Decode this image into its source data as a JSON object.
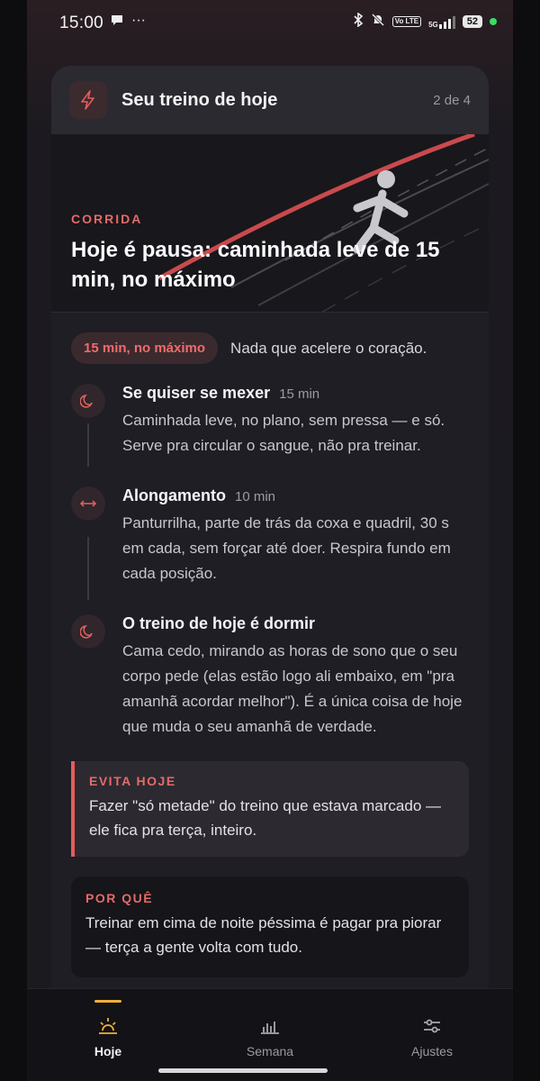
{
  "status": {
    "time": "15:00",
    "battery": "52",
    "volte": "Vo LTE",
    "network": "5G"
  },
  "header": {
    "title": "Seu treino de hoje",
    "count": "2 de 4"
  },
  "hero": {
    "category": "CORRIDA",
    "title": "Hoje é pausa: caminhada leve de 15 min, no máximo"
  },
  "summary": {
    "pill": "15 min, no máximo",
    "note": "Nada que acelere o coração."
  },
  "steps": [
    {
      "icon": "moon-icon",
      "title": "Se quiser se mexer",
      "duration": "15 min",
      "body": "Caminhada leve, no plano, sem pressa — e só. Serve pra circular o sangue, não pra treinar."
    },
    {
      "icon": "stretch-arrows-icon",
      "title": "Alongamento",
      "duration": "10 min",
      "body": "Panturrilha, parte de trás da coxa e quadril, 30 s em cada, sem forçar até doer. Respira fundo em cada posição."
    },
    {
      "icon": "moon-icon",
      "title": "O treino de hoje é dormir",
      "duration": "",
      "body": "Cama cedo, mirando as horas de sono que o seu corpo pede (elas estão logo ali embaixo, em \"pra amanhã acordar melhor\"). É a única coisa de hoje que muda o seu amanhã de verdade."
    }
  ],
  "avoid": {
    "label": "EVITA HOJE",
    "text": "Fazer \"só metade\" do treino que estava marcado — ele fica pra terça, inteiro."
  },
  "why": {
    "label": "POR QUÊ",
    "text": "Treinar em cima de noite péssima é pagar pra piorar — terça a gente volta com tudo."
  },
  "nav": {
    "items": [
      {
        "label": "Hoje",
        "icon": "sunrise-icon",
        "active": true
      },
      {
        "label": "Semana",
        "icon": "bar-chart-icon",
        "active": false
      },
      {
        "label": "Ajustes",
        "icon": "sliders-icon",
        "active": false
      }
    ]
  },
  "colors": {
    "accent": "#e45c5c",
    "active_nav": "#f0b13a",
    "background": "#1e1e24"
  }
}
